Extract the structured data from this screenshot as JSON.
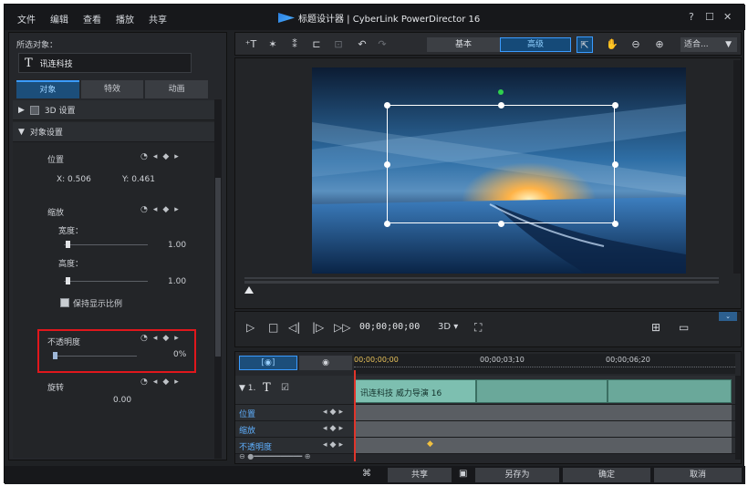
{
  "menubar": {
    "items": [
      "文件",
      "编辑",
      "查看",
      "播放",
      "共享"
    ]
  },
  "window": {
    "title": "标题设计器 | CyberLink PowerDirector 16",
    "help": "?",
    "maximize": "☐",
    "close": "✕"
  },
  "left": {
    "selected_label": "所选对象：",
    "object_name": "讯连科技",
    "tabs": [
      "对象",
      "特效",
      "动画"
    ],
    "sections": {
      "s3d": "3D 设置",
      "obj": "对象设置"
    },
    "position": {
      "label": "位置",
      "x": "X:  0.506",
      "y": "Y:  0.461"
    },
    "scale": {
      "label": "缩放",
      "width_label": "宽度：",
      "width_value": "1.00",
      "height_label": "高度：",
      "height_value": "1.00",
      "keep_ratio": "保持显示比例"
    },
    "opacity": {
      "label": "不透明度",
      "value": "0%"
    },
    "rotation": {
      "label": "旋转",
      "value": "0.00"
    }
  },
  "toolbar": {
    "basic": "基本",
    "advanced": "高级",
    "fit": "适合..."
  },
  "controls": {
    "timecode": "00;00;00;00",
    "mode": "3D ▾"
  },
  "timeline": {
    "ruler": [
      "00;00;00;00",
      "00;00;03;10",
      "00;00;06;20"
    ],
    "track_label": "▼ 1.",
    "clip_text": "讯连科技 威力导演 16",
    "rows": [
      "位置",
      "缩放",
      "不透明度"
    ]
  },
  "footer": {
    "share": "共享",
    "save_as": "另存为",
    "ok": "确定",
    "cancel": "取消"
  }
}
